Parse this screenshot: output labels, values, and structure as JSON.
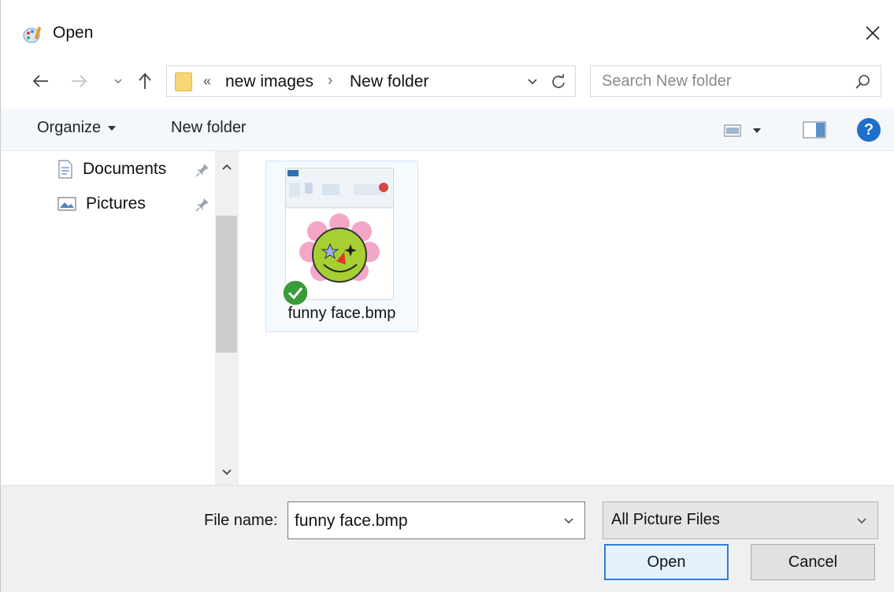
{
  "window": {
    "title": "Open"
  },
  "address": {
    "overflow_marker": "«",
    "breadcrumbs": [
      "new images",
      "New folder"
    ],
    "separator": "›"
  },
  "search": {
    "placeholder": "Search New folder"
  },
  "toolbar": {
    "organize_label": "Organize",
    "new_folder_label": "New folder"
  },
  "nav_pane": {
    "items": [
      {
        "label": "Documents",
        "icon": "documents-icon",
        "pinned": true
      },
      {
        "label": "Pictures",
        "icon": "pictures-icon",
        "pinned": true
      }
    ]
  },
  "files": [
    {
      "name": "funny face.bmp",
      "selected": true
    }
  ],
  "footer": {
    "file_name_label": "File name:",
    "file_name_value": "funny face.bmp",
    "file_type_selected": "All Picture Files",
    "open_label": "Open",
    "cancel_label": "Cancel"
  },
  "colors": {
    "accent": "#2d7ed6",
    "help": "#1d6fc9",
    "folder": "#f7d774",
    "check": "#3a9b3a"
  }
}
